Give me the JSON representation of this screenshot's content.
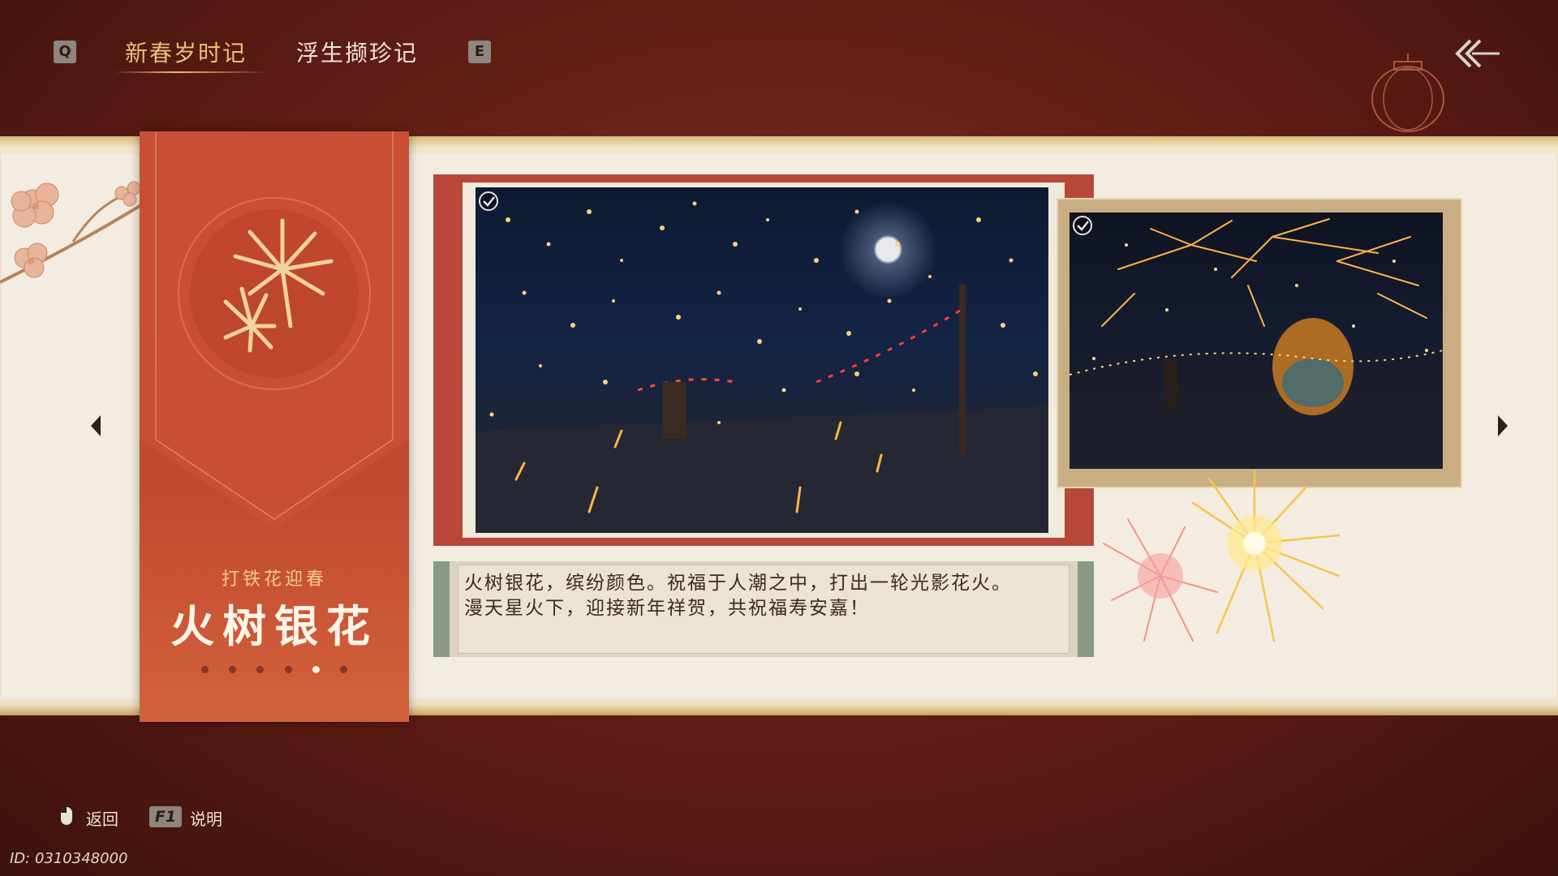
{
  "header": {
    "prev_key": "Q",
    "next_key": "E",
    "tabs": [
      {
        "label": "新春岁时记",
        "active": true
      },
      {
        "label": "浮生撷珍记",
        "active": false
      }
    ],
    "back_icon": "double-chevron-left-arrow-icon"
  },
  "banner": {
    "icon": "fireworks-emblem-icon",
    "subtitle": "打铁花迎春",
    "title": "火树银花",
    "page_indicator": {
      "total": 6,
      "current": 5
    }
  },
  "gallery": {
    "main_image": {
      "subject": "iron-flower fireworks over night market",
      "collected": true
    },
    "side_image": {
      "subject": "sparks above dragon float",
      "collected": true
    }
  },
  "description": {
    "line1": "火树银花，缤纷颜色。祝福于人潮之中，打出一轮光影花火。",
    "line2": "漫天星火下，迎接新年祥贺，共祝福寿安嘉！"
  },
  "footer": {
    "back_label": "返回",
    "help_key": "F1",
    "help_label": "说明",
    "uid": "ID: 0310348000"
  },
  "colors": {
    "accent_gold": "#e8c07a",
    "banner_red": "#c4482f",
    "paper": "#f3ece0",
    "background": "#5c1c14"
  }
}
